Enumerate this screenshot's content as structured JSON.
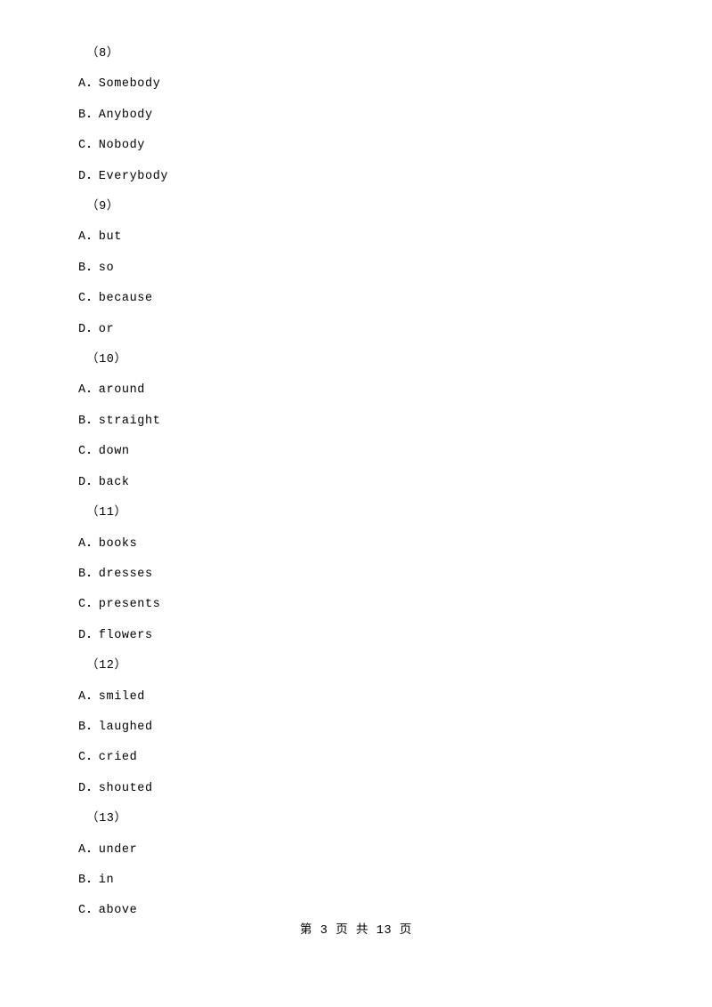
{
  "document": {
    "lines": [
      {
        "text": "（8）",
        "kind": "group"
      },
      {
        "text": "A．Somebody",
        "kind": "option"
      },
      {
        "text": "B．Anybody",
        "kind": "option"
      },
      {
        "text": "C．Nobody",
        "kind": "option"
      },
      {
        "text": "D．Everybody",
        "kind": "option"
      },
      {
        "text": "（9）",
        "kind": "group"
      },
      {
        "text": "A．but",
        "kind": "option"
      },
      {
        "text": "B．so",
        "kind": "option"
      },
      {
        "text": "C．because",
        "kind": "option"
      },
      {
        "text": "D．or",
        "kind": "option"
      },
      {
        "text": "（10）",
        "kind": "group"
      },
      {
        "text": "A．around",
        "kind": "option"
      },
      {
        "text": "B．straight",
        "kind": "option"
      },
      {
        "text": "C．down",
        "kind": "option"
      },
      {
        "text": "D．back",
        "kind": "option"
      },
      {
        "text": "（11）",
        "kind": "group"
      },
      {
        "text": "A．books",
        "kind": "option"
      },
      {
        "text": "B．dresses",
        "kind": "option"
      },
      {
        "text": "C．presents",
        "kind": "option"
      },
      {
        "text": "D．flowers",
        "kind": "option"
      },
      {
        "text": "（12）",
        "kind": "group"
      },
      {
        "text": "A．smiled",
        "kind": "option"
      },
      {
        "text": "B．laughed",
        "kind": "option"
      },
      {
        "text": "C．cried",
        "kind": "option"
      },
      {
        "text": "D．shouted",
        "kind": "option"
      },
      {
        "text": "（13）",
        "kind": "group"
      },
      {
        "text": "A．under",
        "kind": "option"
      },
      {
        "text": "B．in",
        "kind": "option"
      },
      {
        "text": "C．above",
        "kind": "option"
      }
    ],
    "footer": "第 3 页 共 13 页"
  }
}
